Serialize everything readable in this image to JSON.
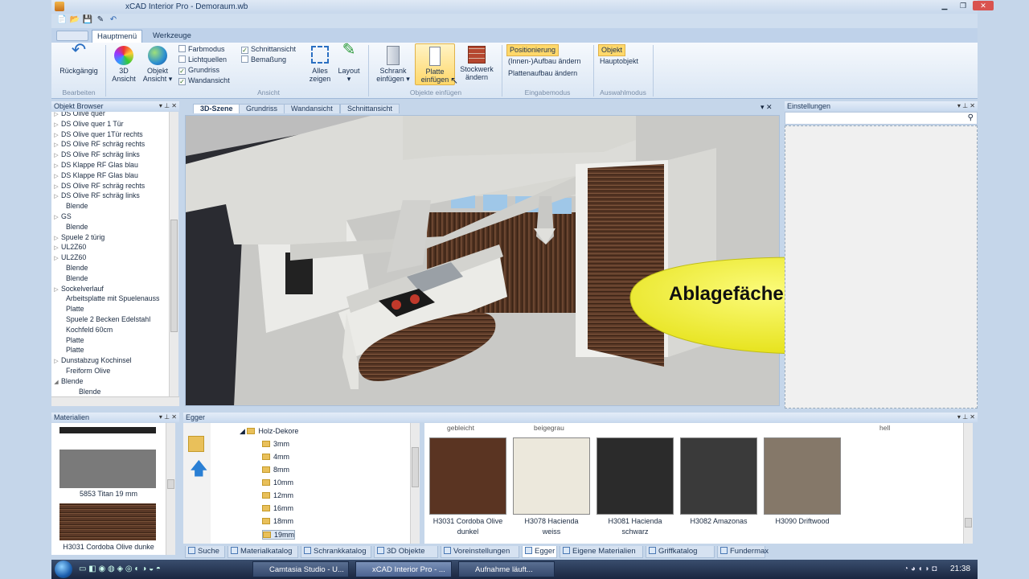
{
  "window": {
    "title": "xCAD Interior Pro - Demoraum.wb"
  },
  "ribbon": {
    "tabs": [
      "Hauptmenü",
      "Werkzeuge"
    ],
    "undo_label": "Rückgängig",
    "group_bearbeiten": "Bearbeiten",
    "view3d_label": [
      "3D",
      "Ansicht"
    ],
    "object_view_label": [
      "Objekt",
      "Ansicht"
    ],
    "checks": {
      "farbmodus": "Farbmodus",
      "lichtquellen": "Lichtquellen",
      "grundriss": "Grundriss",
      "wandansicht": "Wandansicht",
      "schnittansicht": "Schnittansicht",
      "bemassung": "Bemaßung"
    },
    "group_ansicht": "Ansicht",
    "alles_zeigen": [
      "Alles",
      "zeigen"
    ],
    "layout": "Layout",
    "schrank": [
      "Schrank",
      "einfügen"
    ],
    "platte": [
      "Platte",
      "einfügen"
    ],
    "stockwerk": [
      "Stockwerk",
      "ändern"
    ],
    "group_objekte": "Objekte einfügen",
    "positionierung": "Positionierung",
    "innen_aufbau": "(Innen-)Aufbau ändern",
    "plattenaufbau": "Plattenaufbau ändern",
    "group_eingabe": "Eingabemodus",
    "objekt": "Objekt",
    "hauptobjekt": "Hauptobjekt",
    "group_auswahl": "Auswahlmodus"
  },
  "object_browser": {
    "title": "Objekt Browser",
    "items": [
      {
        "label": "DS Olive quer",
        "expand": true
      },
      {
        "label": "DS Olive quer 1 Tür",
        "expand": true
      },
      {
        "label": "DS Olive quer 1Tür rechts",
        "expand": true
      },
      {
        "label": "DS Olive RF schräg rechts",
        "expand": true
      },
      {
        "label": "DS Olive RF schräg links",
        "expand": true
      },
      {
        "label": "DS Klappe RF Glas blau",
        "expand": true
      },
      {
        "label": "DS Klappe RF Glas blau",
        "expand": true
      },
      {
        "label": "DS Olive RF schräg rechts",
        "expand": true
      },
      {
        "label": "DS Olive RF schräg links",
        "expand": true
      },
      {
        "label": "Blende",
        "expand": false
      },
      {
        "label": "GS",
        "expand": true
      },
      {
        "label": "Blende",
        "expand": false
      },
      {
        "label": "Spuele 2 türig",
        "expand": true
      },
      {
        "label": "UL2Z60",
        "expand": true
      },
      {
        "label": "UL2Z60",
        "expand": true
      },
      {
        "label": "Blende",
        "expand": false
      },
      {
        "label": "Blende",
        "expand": false
      },
      {
        "label": "Sockelverlauf",
        "expand": true
      },
      {
        "label": "Arbeitsplatte mit Spuelenauss",
        "expand": false
      },
      {
        "label": "Platte",
        "expand": false
      },
      {
        "label": "Spuele 2 Becken Edelstahl",
        "expand": false
      },
      {
        "label": "Kochfeld 60cm",
        "expand": false
      },
      {
        "label": "Platte",
        "expand": false
      },
      {
        "label": "Platte",
        "expand": false
      },
      {
        "label": "Dunstabzug Kochinsel",
        "expand": true
      },
      {
        "label": "Freiform Olive",
        "expand": false
      },
      {
        "label": "Blende",
        "expand": "open"
      },
      {
        "label": "Blende",
        "expand": "child"
      }
    ]
  },
  "scene_tabs": [
    "3D-Szene",
    "Grundriss",
    "Wandansicht",
    "Schnittansicht"
  ],
  "callout": "Ablagefächer einfügen",
  "settings": {
    "title": "Einstellungen"
  },
  "materials": {
    "title": "Materialien",
    "items": [
      "5853 Titan 19 mm",
      "H3031 Cordoba Olive dunke"
    ]
  },
  "egger": {
    "title": "Egger",
    "tree_root": "Holz-Dekore",
    "folders": [
      "3mm",
      "4mm",
      "8mm",
      "10mm",
      "12mm",
      "16mm",
      "18mm",
      "19mm"
    ],
    "top_partial": [
      "gebleicht",
      "beigegrau",
      "hell"
    ],
    "swatches": [
      {
        "name": [
          "H3031 Cordoba Olive",
          "dunkel"
        ],
        "color": "#5a3422"
      },
      {
        "name": [
          "H3078 Hacienda",
          "weiss"
        ],
        "color": "#ece8dc"
      },
      {
        "name": [
          "H3081 Hacienda",
          "schwarz"
        ],
        "color": "#2b2b2b"
      },
      {
        "name": [
          "H3082 Amazonas",
          ""
        ],
        "color": "#3a3a3a"
      },
      {
        "name": [
          "H3090 Driftwood",
          ""
        ],
        "color": "#857869"
      }
    ]
  },
  "bottom_tabs": [
    "Suche",
    "Materialkatalog",
    "Schrankkatalog",
    "3D Objekte",
    "Voreinstellungen",
    "Egger",
    "Eigene Materialien",
    "Griffkatalog",
    "Fundermax"
  ],
  "taskbar": {
    "buttons": [
      "Camtasia Studio - U...",
      "xCAD Interior Pro - ...",
      "Aufnahme läuft..."
    ],
    "clock": "21:38"
  }
}
